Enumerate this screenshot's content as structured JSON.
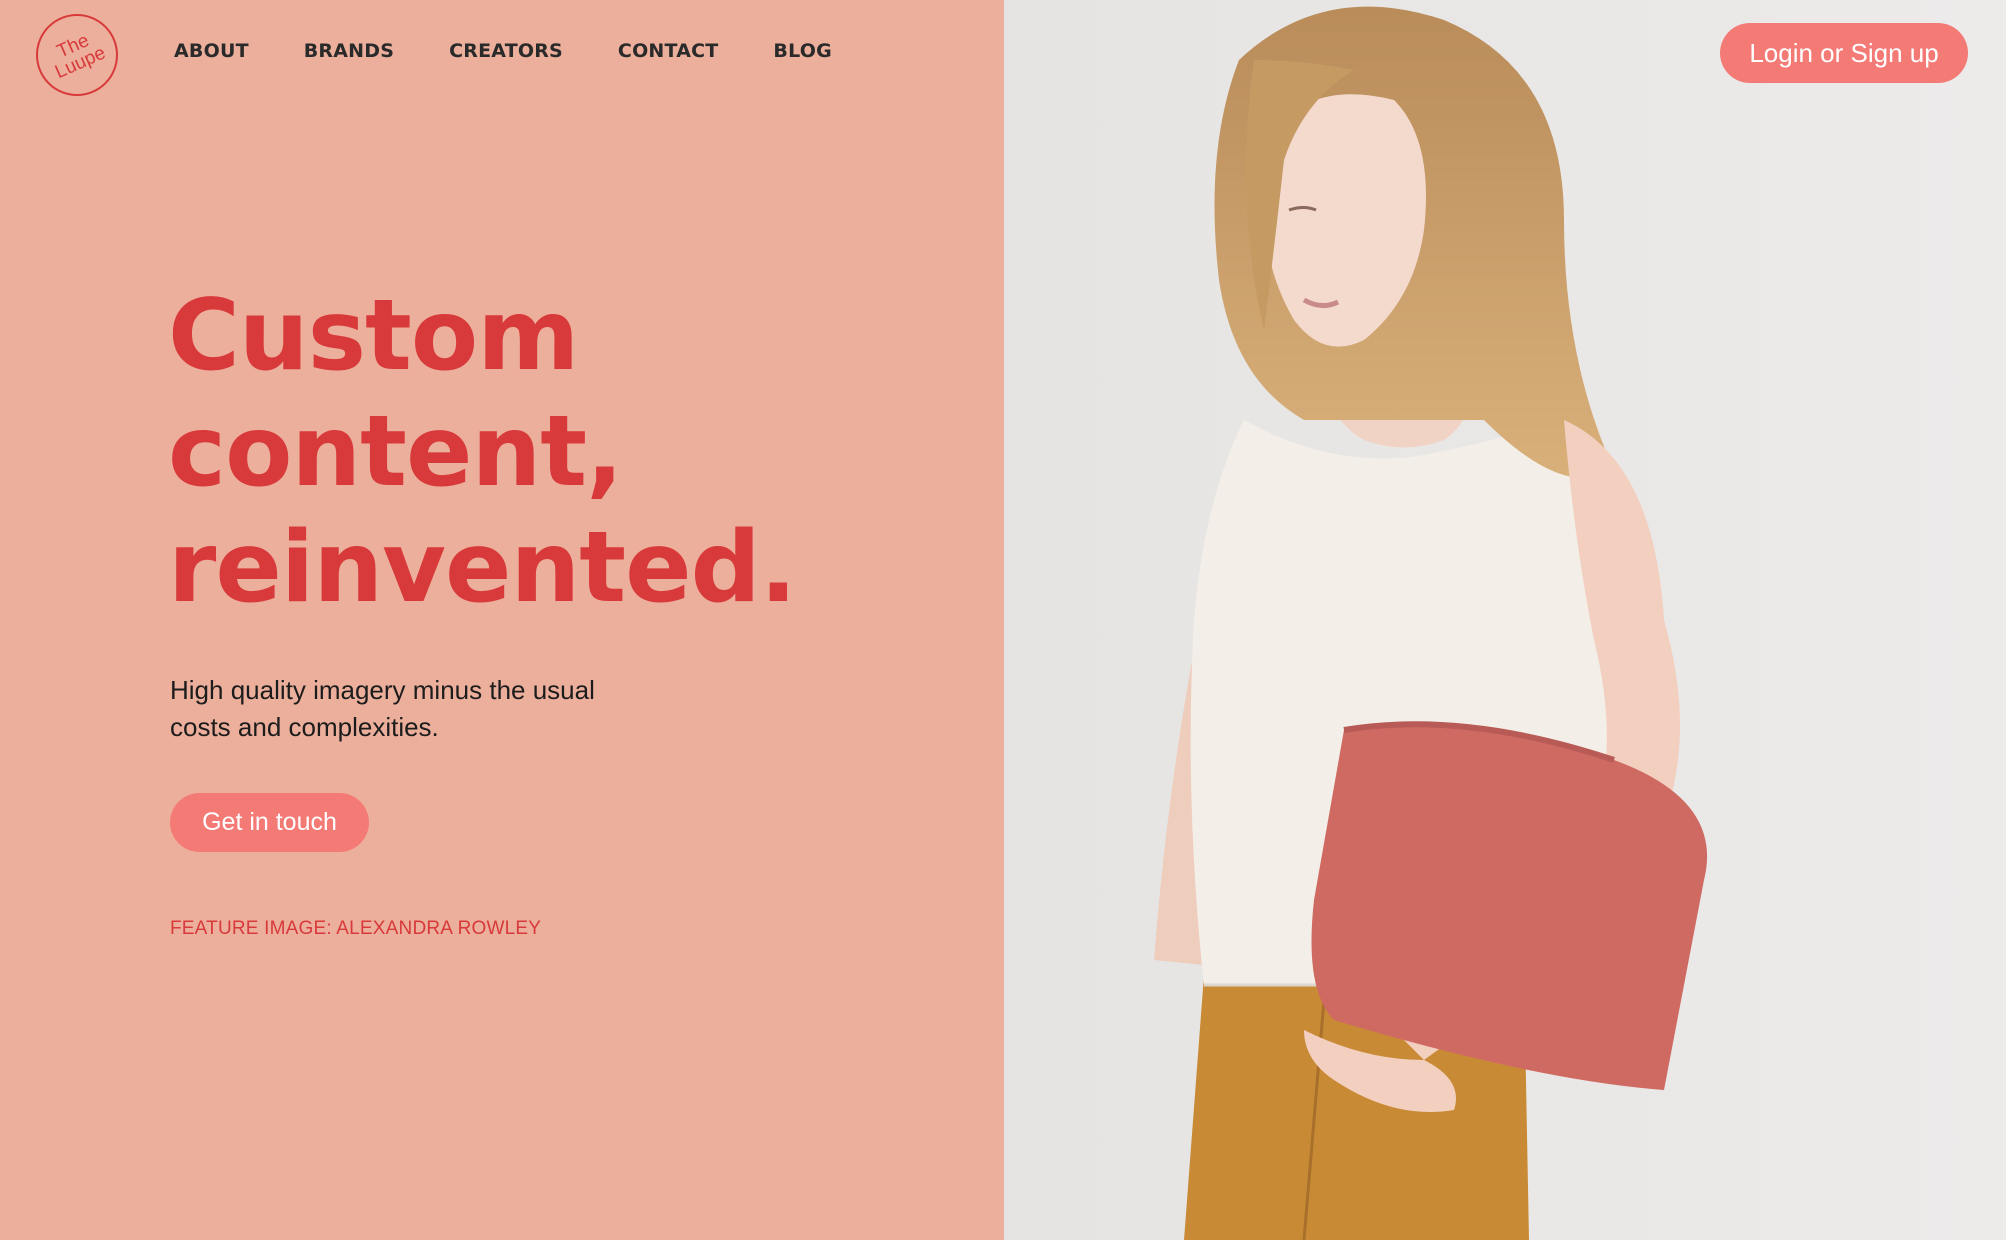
{
  "brand": {
    "logo_line1": "The",
    "logo_line2": "Luupe"
  },
  "nav": {
    "items": [
      "ABOUT",
      "BRANDS",
      "CREATORS",
      "CONTACT",
      "BLOG"
    ]
  },
  "header": {
    "login_label": "Login or Sign up"
  },
  "hero": {
    "headline_lines": [
      "Custom",
      "content,",
      "reinvented."
    ],
    "subtext_line1": "High quality imagery minus the usual",
    "subtext_line2": "costs and complexities.",
    "cta_label": "Get in touch",
    "credit": "FEATURE IMAGE: ALEXANDRA ROWLEY"
  },
  "colors": {
    "panel_bg": "#ecaf9c",
    "accent_red": "#d8393a",
    "button_coral": "#f47a76",
    "photo_bg": "#e7e5e3"
  }
}
